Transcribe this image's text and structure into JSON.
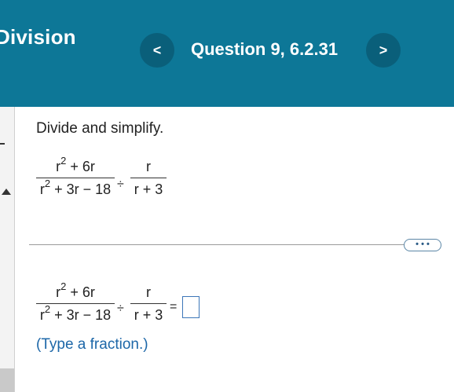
{
  "header": {
    "title": "Division",
    "prev_label": "<",
    "next_label": ">",
    "question": "Question 9, 6.2.31"
  },
  "problem": {
    "instruction": "Divide and simplify.",
    "f1_num_base": "r",
    "f1_num_exp": "2",
    "f1_num_rest": " + 6r",
    "f1_den_base": "r",
    "f1_den_exp": "2",
    "f1_den_rest": " + 3r − 18",
    "op_div": "÷",
    "f2_num": "r",
    "f2_den": "r + 3",
    "equals": "=",
    "hint": "(Type a fraction.)"
  },
  "more_label": "• • •"
}
